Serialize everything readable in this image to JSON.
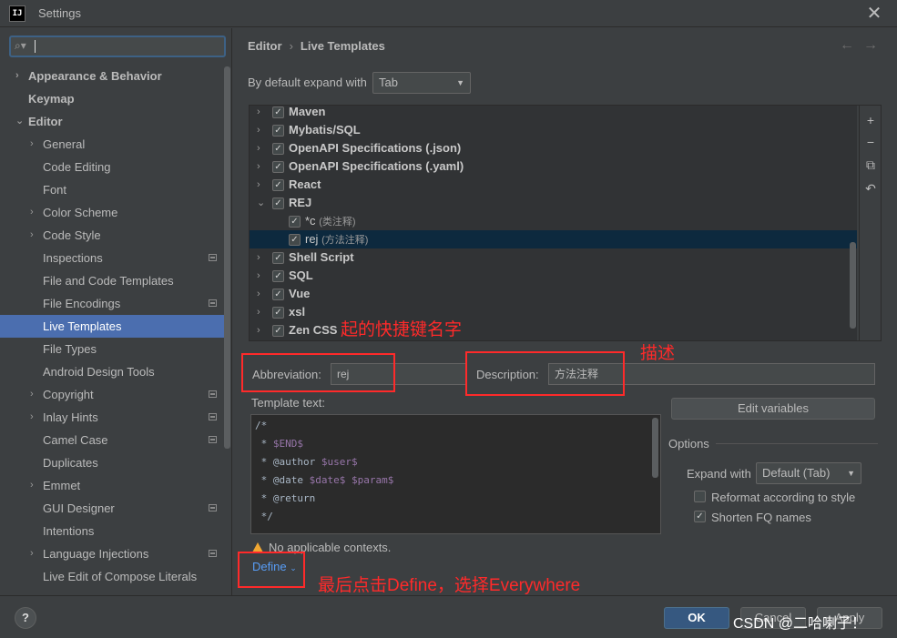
{
  "window": {
    "title": "Settings",
    "logo": "IJ"
  },
  "search": {
    "value": "",
    "icon": "search-icon"
  },
  "sidebar": {
    "items": [
      {
        "label": "Appearance & Behavior",
        "arrow": "›",
        "bold": true,
        "level": 0
      },
      {
        "label": "Keymap",
        "arrow": "",
        "bold": true,
        "level": 0
      },
      {
        "label": "Editor",
        "arrow": "⌄",
        "bold": true,
        "level": 0
      },
      {
        "label": "General",
        "arrow": "›",
        "level": 1
      },
      {
        "label": "Code Editing",
        "arrow": "",
        "level": 1
      },
      {
        "label": "Font",
        "arrow": "",
        "level": 1
      },
      {
        "label": "Color Scheme",
        "arrow": "›",
        "level": 1
      },
      {
        "label": "Code Style",
        "arrow": "›",
        "level": 1
      },
      {
        "label": "Inspections",
        "arrow": "",
        "level": 1,
        "proj": true
      },
      {
        "label": "File and Code Templates",
        "arrow": "",
        "level": 1
      },
      {
        "label": "File Encodings",
        "arrow": "",
        "level": 1,
        "proj": true
      },
      {
        "label": "Live Templates",
        "arrow": "",
        "level": 1,
        "selected": true
      },
      {
        "label": "File Types",
        "arrow": "",
        "level": 1
      },
      {
        "label": "Android Design Tools",
        "arrow": "",
        "level": 1
      },
      {
        "label": "Copyright",
        "arrow": "›",
        "level": 1,
        "proj": true
      },
      {
        "label": "Inlay Hints",
        "arrow": "›",
        "level": 1,
        "proj": true
      },
      {
        "label": "Camel Case",
        "arrow": "",
        "level": 1,
        "proj": true
      },
      {
        "label": "Duplicates",
        "arrow": "",
        "level": 1
      },
      {
        "label": "Emmet",
        "arrow": "›",
        "level": 1
      },
      {
        "label": "GUI Designer",
        "arrow": "",
        "level": 1,
        "proj": true
      },
      {
        "label": "Intentions",
        "arrow": "",
        "level": 1
      },
      {
        "label": "Language Injections",
        "arrow": "›",
        "level": 1,
        "proj": true
      },
      {
        "label": "Live Edit of Compose Literals",
        "arrow": "",
        "level": 1
      }
    ]
  },
  "breadcrumb": {
    "parent": "Editor",
    "separator": "›",
    "current": "Live Templates"
  },
  "nav": {
    "back": "←",
    "forward": "→"
  },
  "expand": {
    "label": "By default expand with",
    "value": "Tab"
  },
  "templates": [
    {
      "label": "Maven",
      "arrow": "›",
      "checked": true,
      "child": false
    },
    {
      "label": "Mybatis/SQL",
      "arrow": "›",
      "checked": true,
      "child": false
    },
    {
      "label": "OpenAPI Specifications (.json)",
      "arrow": "›",
      "checked": true,
      "child": false
    },
    {
      "label": "OpenAPI Specifications (.yaml)",
      "arrow": "›",
      "checked": true,
      "child": false
    },
    {
      "label": "React",
      "arrow": "›",
      "checked": true,
      "child": false
    },
    {
      "label": "REJ",
      "arrow": "⌄",
      "checked": true,
      "child": false
    },
    {
      "label": "*c",
      "desc": "(类注释)",
      "arrow": "",
      "checked": true,
      "child": true
    },
    {
      "label": "rej",
      "desc": "(方法注释)",
      "arrow": "",
      "checked": true,
      "child": true,
      "selected": true
    },
    {
      "label": "Shell Script",
      "arrow": "›",
      "checked": true,
      "child": false
    },
    {
      "label": "SQL",
      "arrow": "›",
      "checked": true,
      "child": false
    },
    {
      "label": "Vue",
      "arrow": "›",
      "checked": true,
      "child": false
    },
    {
      "label": "xsl",
      "arrow": "›",
      "checked": true,
      "child": false
    },
    {
      "label": "Zen CSS",
      "arrow": "›",
      "checked": true,
      "child": false
    }
  ],
  "tools": {
    "add": "+",
    "remove": "−",
    "copy": "⧉",
    "revert": "↶"
  },
  "annotations": {
    "shortcut_name": "起的快捷键名字",
    "description": "描述",
    "define_hint": "最后点击Define，选择Everywhere"
  },
  "abbreviation": {
    "label": "Abbreviation:",
    "value": "rej"
  },
  "description": {
    "label": "Description:",
    "value": "方法注释"
  },
  "template_text": {
    "label": "Template text:",
    "lines": [
      [
        {
          "t": "/*"
        }
      ],
      [
        {
          "t": " * "
        },
        {
          "t": "$END$",
          "v": true
        }
      ],
      [
        {
          "t": " * @author "
        },
        {
          "t": "$user$",
          "v": true
        }
      ],
      [
        {
          "t": " * @date "
        },
        {
          "t": "$date$",
          "v": true
        },
        {
          "t": " "
        },
        {
          "t": "$param$",
          "v": true
        }
      ],
      [
        {
          "t": " * @return"
        }
      ],
      [
        {
          "t": " */"
        }
      ]
    ]
  },
  "edit_variables": "Edit variables",
  "options": {
    "title": "Options",
    "expand_label": "Expand with",
    "expand_value": "Default (Tab)",
    "reformat": {
      "label": "Reformat according to style",
      "checked": false
    },
    "shorten": {
      "label": "Shorten FQ names",
      "checked": true
    }
  },
  "warning": "No applicable contexts.",
  "define": "Define",
  "buttons": {
    "ok": "OK",
    "cancel": "Cancel",
    "apply": "Apply"
  },
  "watermark": "CSDN @二哈喇子！",
  "help": "?"
}
